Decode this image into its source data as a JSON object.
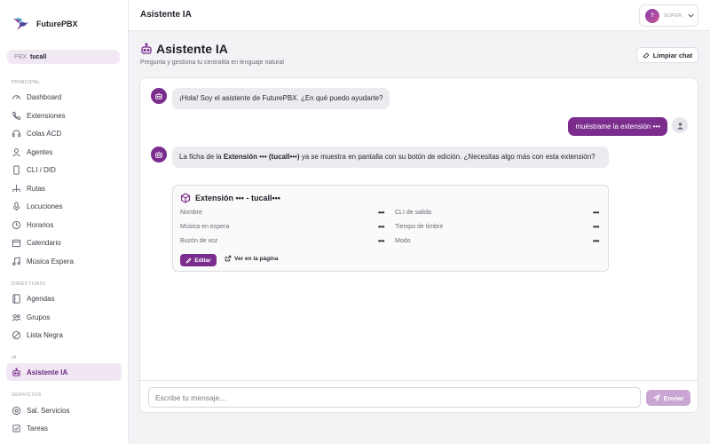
{
  "app": {
    "name": "FuturePBX"
  },
  "tenant": {
    "key": "PBX",
    "value": "tucall"
  },
  "sidebar": {
    "sections": {
      "principal": "PRINCIPAL",
      "directorio": "DIRECTORIO",
      "ia": "IA",
      "servicios": "SERVICIOS"
    },
    "principal_items": [
      {
        "label": "Dashboard",
        "icon": "gauge-icon"
      },
      {
        "label": "Extensiones",
        "icon": "phone-icon"
      },
      {
        "label": "Colas ACD",
        "icon": "headset-icon"
      },
      {
        "label": "Agentes",
        "icon": "user-icon"
      },
      {
        "label": "CLI / DID",
        "icon": "mobile-icon"
      },
      {
        "label": "Rutas",
        "icon": "routes-icon"
      },
      {
        "label": "Locuciones",
        "icon": "microphone-icon"
      },
      {
        "label": "Horarios",
        "icon": "clock-icon"
      },
      {
        "label": "Calendario",
        "icon": "calendar-icon"
      },
      {
        "label": "Música Espera",
        "icon": "music-icon"
      }
    ],
    "directorio_items": [
      {
        "label": "Agendas",
        "icon": "book-icon"
      },
      {
        "label": "Grupos",
        "icon": "group-icon"
      },
      {
        "label": "Lista Negra",
        "icon": "block-icon"
      }
    ],
    "ia_items": [
      {
        "label": "Asistente IA",
        "icon": "robot-icon",
        "active": true
      }
    ],
    "servicios_items": [
      {
        "label": "Sal. Servicios",
        "icon": "service-icon"
      },
      {
        "label": "Tareas",
        "icon": "tasks-icon"
      }
    ]
  },
  "topbar": {
    "title": "Asistente IA",
    "user_initial": "?",
    "user_role": "SUPER"
  },
  "page": {
    "title": "Asistente IA",
    "subtitle": "Pregunta y gestiona tu centralita en lenguaje natural",
    "clear_label": "Limpiar chat"
  },
  "chat": {
    "greeting": "¡Hola! Soy el asistente de FuturePBX. ¿En qué puedo ayudarte?",
    "user_message": "muéstrame la extensión •••",
    "reply_pre": "La ficha de la ",
    "reply_bold": "Extensión ••• (tucall•••)",
    "reply_post": " ya se muestra en pantalla con su botón de edición. ¿Necesitas algo más con esta extensión?",
    "card": {
      "title": "Extensión ••• - tucall•••",
      "fields_left": [
        {
          "label": "Nombre",
          "value": "•••"
        },
        {
          "label": "Música en espera",
          "value": "•••"
        },
        {
          "label": "Buzón de voz",
          "value": "•••"
        }
      ],
      "fields_right": [
        {
          "label": "CLI de salida",
          "value": "•••"
        },
        {
          "label": "Tiempo de timbre",
          "value": "•••"
        },
        {
          "label": "Modo",
          "value": "•••"
        }
      ],
      "edit_label": "Editar",
      "view_label": "Ver en la página"
    }
  },
  "composer": {
    "placeholder": "Escribe tu mensaje...",
    "send_label": "Enviar"
  },
  "colors": {
    "accent": "#7b2d8e",
    "accent_light": "#c9a6d4"
  }
}
